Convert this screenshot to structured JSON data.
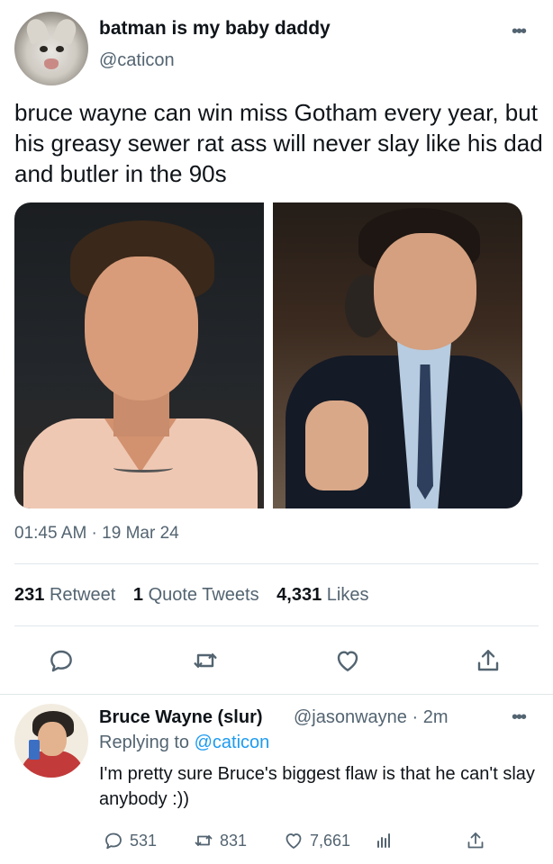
{
  "tweet": {
    "display_name": "batman is my baby daddy",
    "handle": "@caticon",
    "more": "•••",
    "text": "bruce wayne can win miss Gotham every year, but his greasy sewer rat ass will never slay like his dad and butler in the 90s",
    "timestamp": "01:45 AM · 19 Mar 24",
    "stats": {
      "retweets_num": "231",
      "retweets_label": "Retweet",
      "quotes_num": "1",
      "quotes_label": "Quote Tweets",
      "likes_num": "4,331",
      "likes_label": "Likes"
    },
    "actions": [
      "reply-icon",
      "retweet-icon",
      "like-icon",
      "share-icon"
    ]
  },
  "reply": {
    "display_name": "Bruce Wayne (slur)",
    "meta": "@jasonwayne · 2m",
    "more": "•••",
    "replying_prefix": "Replying to",
    "replying_handle": "@caticon",
    "text": "I'm pretty sure Bruce's biggest flaw is that he can't slay anybody :))",
    "counts": {
      "replies": "531",
      "retweets": "831",
      "likes": "7,661"
    }
  },
  "colors": {
    "text_primary": "#0f1419",
    "text_secondary": "#536471",
    "link": "#1d9bf0",
    "divider": "#e1e6ea"
  }
}
